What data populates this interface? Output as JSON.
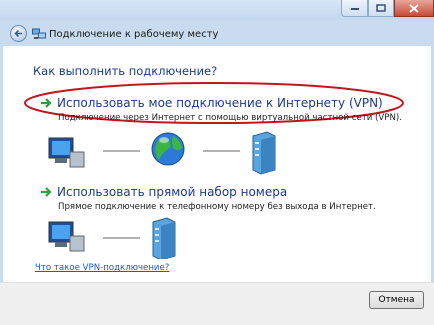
{
  "window": {
    "title": "Подключение к рабочему месту"
  },
  "main": {
    "heading": "Как выполнить подключение?",
    "options": [
      {
        "title": "Использовать мое подключение к Интернету (VPN)",
        "description": "Подключение через Интернет с помощью виртуальной частной сети (VPN).",
        "highlighted": true
      },
      {
        "title": "Использовать прямой набор номера",
        "description": "Прямое подключение к телефонному номеру без выхода в Интернет."
      }
    ],
    "help_link": "Что такое VPN-подключение?"
  },
  "footer": {
    "cancel_label": "Отмена"
  },
  "colors": {
    "heading": "#1e3a8a",
    "arrow": "#2e9e3e",
    "highlight_ellipse": "#c0171d",
    "link": "#1e5bbf"
  },
  "icons": [
    "back-arrow-icon",
    "network-icon",
    "computer-icon",
    "globe-icon",
    "server-icon",
    "green-arrow-icon"
  ]
}
